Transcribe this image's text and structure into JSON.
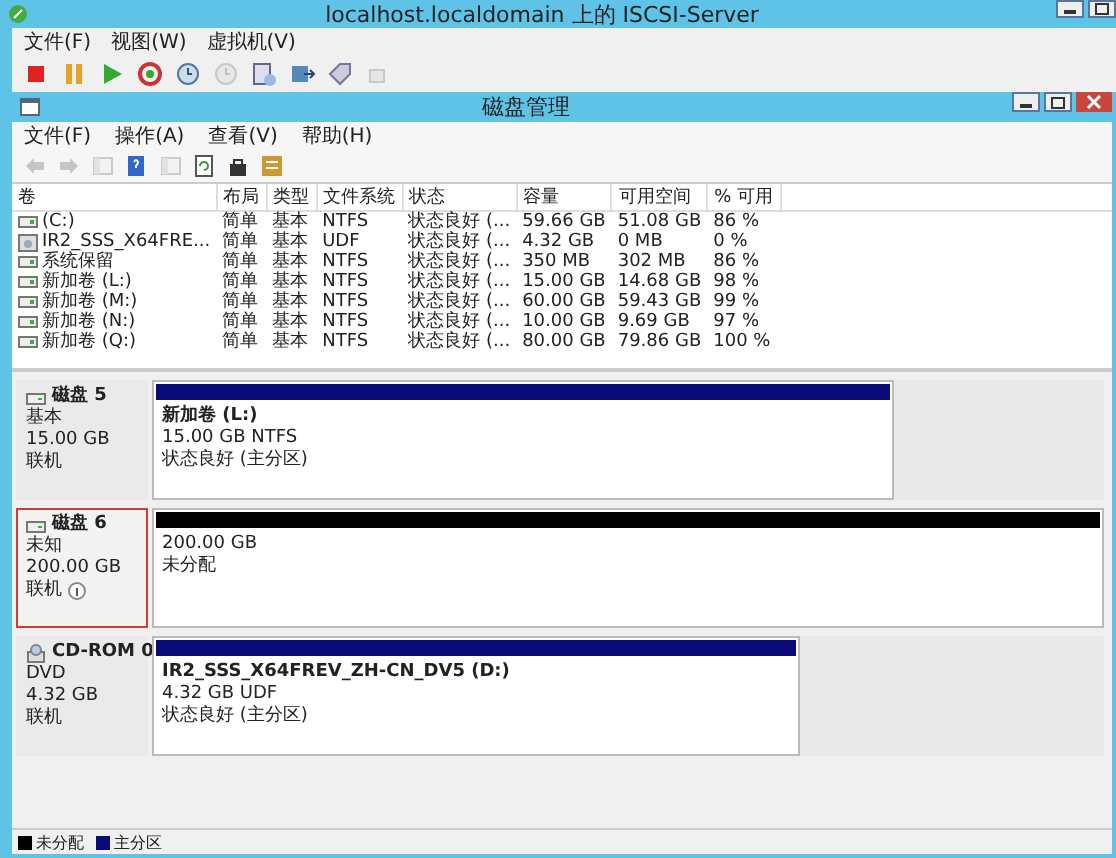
{
  "window": {
    "title": "localhost.localdomain 上的 ISCSI-Server",
    "menu": [
      "文件(F)",
      "视图(W)",
      "虚拟机(V)"
    ],
    "toolbar": [
      {
        "kind": "stop",
        "disabled": false
      },
      {
        "kind": "pause",
        "disabled": false
      },
      {
        "kind": "play",
        "disabled": false
      },
      {
        "kind": "reset",
        "disabled": false
      },
      {
        "kind": "snapshot",
        "disabled": false
      },
      {
        "kind": "revert",
        "disabled": true
      },
      {
        "kind": "manage",
        "disabled": false
      },
      {
        "kind": "save",
        "disabled": false
      },
      {
        "kind": "tag",
        "disabled": false
      },
      {
        "kind": "share",
        "disabled": true
      }
    ]
  },
  "inner_window": {
    "title": "磁盘管理",
    "menu": [
      "文件(F)",
      "操作(A)",
      "查看(V)",
      "帮助(H)"
    ],
    "toolbar": [
      {
        "kind": "back",
        "disabled": true
      },
      {
        "kind": "forward",
        "disabled": true
      },
      {
        "kind": "panel",
        "disabled": true
      },
      {
        "kind": "help",
        "disabled": false
      },
      {
        "kind": "panel",
        "disabled": true
      },
      {
        "kind": "refresh",
        "disabled": false
      },
      {
        "kind": "lock",
        "disabled": false
      },
      {
        "kind": "props",
        "disabled": false
      }
    ]
  },
  "table": {
    "columns": [
      "卷",
      "布局",
      "类型",
      "文件系统",
      "状态",
      "容量",
      "可用空间",
      "% 可用"
    ],
    "rows": [
      {
        "kind": "drive",
        "cells": [
          "(C:)",
          "简单",
          "基本",
          "NTFS",
          "状态良好 (...",
          "59.66 GB",
          "51.08 GB",
          "86 %"
        ]
      },
      {
        "kind": "disc",
        "cells": [
          "IR2_SSS_X64FRE...",
          "简单",
          "基本",
          "UDF",
          "状态良好 (...",
          "4.32 GB",
          "0 MB",
          "0 %"
        ]
      },
      {
        "kind": "drive",
        "cells": [
          "系统保留",
          "简单",
          "基本",
          "NTFS",
          "状态良好 (...",
          "350 MB",
          "302 MB",
          "86 %"
        ]
      },
      {
        "kind": "drive",
        "cells": [
          "新加卷 (L:)",
          "简单",
          "基本",
          "NTFS",
          "状态良好 (...",
          "15.00 GB",
          "14.68 GB",
          "98 %"
        ]
      },
      {
        "kind": "drive",
        "cells": [
          "新加卷 (M:)",
          "简单",
          "基本",
          "NTFS",
          "状态良好 (...",
          "60.00 GB",
          "59.43 GB",
          "99 %"
        ]
      },
      {
        "kind": "drive",
        "cells": [
          "新加卷 (N:)",
          "简单",
          "基本",
          "NTFS",
          "状态良好 (...",
          "10.00 GB",
          "9.69 GB",
          "97 %"
        ]
      },
      {
        "kind": "drive",
        "cells": [
          "新加卷 (Q:)",
          "简单",
          "基本",
          "NTFS",
          "状态良好 (...",
          "80.00 GB",
          "79.86 GB",
          "100 %"
        ]
      }
    ]
  },
  "disks": [
    {
      "kind": "disk",
      "selected": false,
      "name": "磁盘 5",
      "type": "基本",
      "size": "15.00 GB",
      "status": "联机",
      "info": false,
      "partition": {
        "kind": "primary",
        "title": "新加卷 (L:)",
        "lines": [
          "15.00 GB NTFS",
          "状态良好 (主分区)"
        ]
      }
    },
    {
      "kind": "disk",
      "selected": true,
      "name": "磁盘 6",
      "type": "未知",
      "size": "200.00 GB",
      "status": "联机",
      "info": true,
      "partition": {
        "kind": "unallocated",
        "lines": [
          "200.00 GB",
          "未分配"
        ]
      }
    },
    {
      "kind": "cdrom",
      "selected": false,
      "name": "CD-ROM 0",
      "type": "DVD",
      "size": "4.32 GB",
      "status": "联机",
      "info": false,
      "partition": {
        "kind": "primary",
        "title": "IR2_SSS_X64FREV_ZH-CN_DV5  (D:)",
        "lines": [
          "4.32 GB UDF",
          "状态良好 (主分区)"
        ]
      }
    }
  ],
  "legend": [
    {
      "kind": "unallocated",
      "label": "未分配"
    },
    {
      "kind": "primary",
      "label": "主分区"
    }
  ]
}
